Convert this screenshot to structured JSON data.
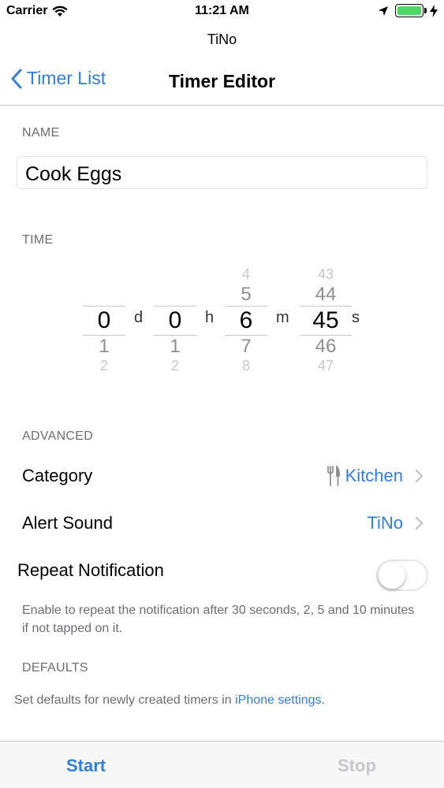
{
  "status_bar": {
    "carrier": "Carrier",
    "time": "11:21 AM"
  },
  "app_title": "TiNo",
  "nav": {
    "back_label": "Timer List",
    "title": "Timer Editor"
  },
  "sections": {
    "name_header": "NAME",
    "time_header": "TIME",
    "advanced_header": "ADVANCED",
    "defaults_header": "DEFAULTS"
  },
  "name_field": {
    "value": "Cook Eggs"
  },
  "picker": {
    "days": {
      "above2": "",
      "above1": "",
      "selected": "0",
      "below1": "1",
      "below2": "2",
      "unit": "d"
    },
    "hours": {
      "above2": "",
      "above1": "",
      "selected": "0",
      "below1": "1",
      "below2": "2",
      "unit": "h"
    },
    "minutes": {
      "above2": "4",
      "above1": "5",
      "selected": "6",
      "below1": "7",
      "below2": "8",
      "unit": "m"
    },
    "seconds": {
      "above2": "43",
      "above1": "44",
      "selected": "45",
      "below1": "46",
      "below2": "47",
      "unit": "s"
    }
  },
  "advanced": {
    "category_label": "Category",
    "category_value": "Kitchen",
    "alert_label": "Alert Sound",
    "alert_value": "TiNo",
    "repeat_label": "Repeat Notification",
    "repeat_on": false,
    "repeat_note": "Enable to repeat the notification after 30 seconds, 2, 5 and 10 minutes if not tapped on it."
  },
  "defaults": {
    "note_text": "Set defaults for newly created timers in ",
    "link_text": "iPhone settings",
    "note_end": "."
  },
  "toolbar": {
    "start_label": "Start",
    "stop_label": "Stop"
  },
  "colors": {
    "accent": "#2f7fe0",
    "disabled": "#c7c7cc",
    "battery": "#4cd964"
  }
}
